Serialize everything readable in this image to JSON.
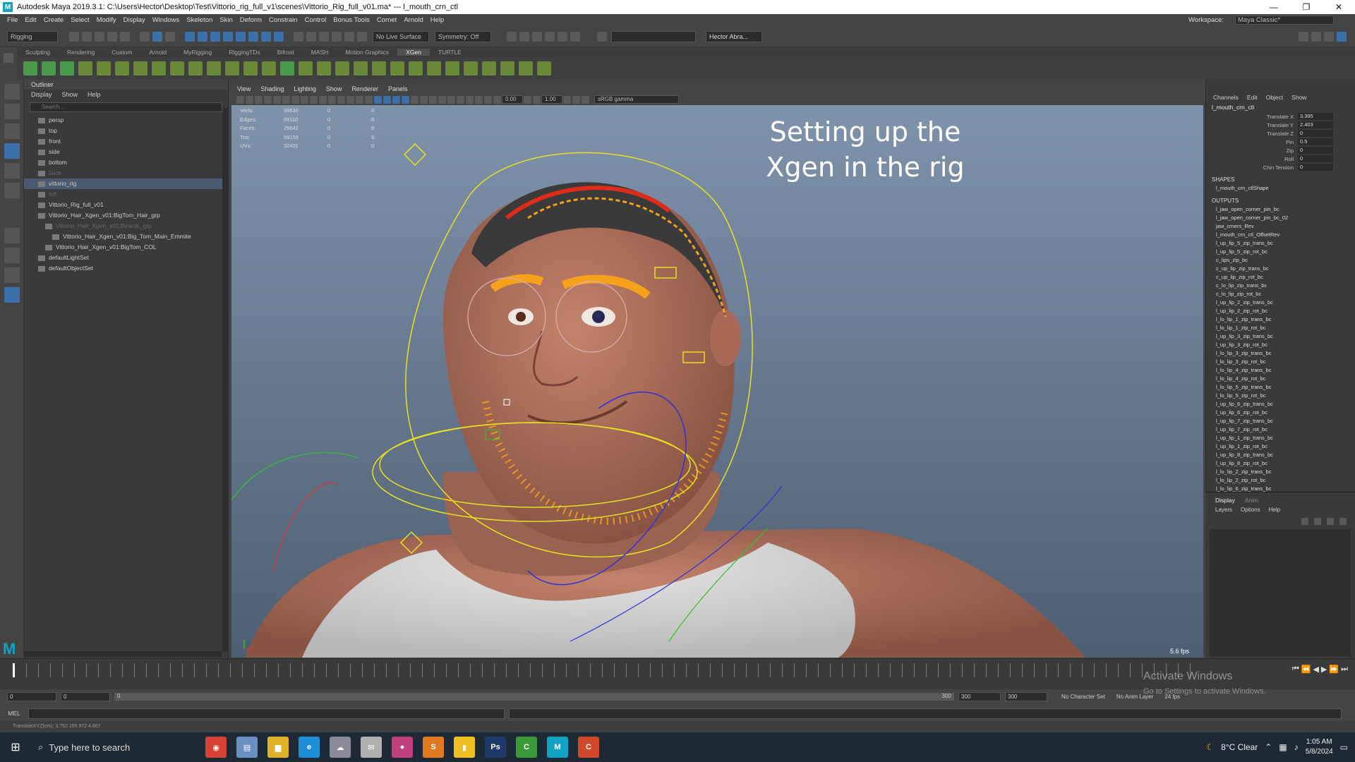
{
  "window": {
    "title": "Autodesk Maya 2019.3.1: C:\\Users\\Hector\\Desktop\\Test\\Vittorio_rig_full_v1\\scenes\\Vittorio_Rig_full_v01.ma*  ---  l_mouth_crn_ctl",
    "controls": [
      "—",
      "❐",
      "✕"
    ]
  },
  "menubar": {
    "items": [
      "File",
      "Edit",
      "Create",
      "Select",
      "Modify",
      "Display",
      "Windows",
      "Skeleton",
      "Skin",
      "Deform",
      "Constrain",
      "Control",
      "Bonus Tools",
      "Cornet",
      "Arnold",
      "Help"
    ],
    "workspace_label": "Workspace:",
    "workspace_value": "Maya Classic*"
  },
  "statusline": {
    "mode": "Rigging",
    "live_surface": "No Live Surface",
    "symmetry": "Symmetry: Off",
    "user": "Hector Abra..."
  },
  "shelf": {
    "tabs": [
      "Sculpting",
      "Rendering",
      "Custom",
      "Arnold",
      "MyRigging",
      "RiggingTDs",
      "Bifrost",
      "MASH",
      "Motion Graphics",
      "XGen",
      "TURTLE"
    ],
    "active_tab": "XGen"
  },
  "outliner": {
    "title": "Outliner",
    "menu": [
      "Display",
      "Show",
      "Help"
    ],
    "search_placeholder": "Search...",
    "items": [
      {
        "label": "persp",
        "indent": 1,
        "dim": false,
        "selected": false
      },
      {
        "label": "top",
        "indent": 1,
        "dim": false,
        "selected": false
      },
      {
        "label": "front",
        "indent": 1,
        "dim": false,
        "selected": false
      },
      {
        "label": "side",
        "indent": 1,
        "dim": false,
        "selected": false
      },
      {
        "label": "bottom",
        "indent": 1,
        "dim": false,
        "selected": false
      },
      {
        "label": "back",
        "indent": 1,
        "dim": true,
        "selected": false
      },
      {
        "label": "vittorio_rig",
        "indent": 1,
        "dim": false,
        "selected": true
      },
      {
        "label": "left",
        "indent": 1,
        "dim": true,
        "selected": false
      },
      {
        "label": "Vittorio_Rig_full_v01",
        "indent": 1,
        "dim": false,
        "selected": false
      },
      {
        "label": "Vittorio_Hair_Xgen_v01:BigTom_Hair_grp",
        "indent": 1,
        "dim": false,
        "selected": false
      },
      {
        "label": "Vittorio_Hair_Xgen_v01:Beards_grp",
        "indent": 2,
        "dim": true,
        "selected": false
      },
      {
        "label": "Vittorio_Hair_Xgen_v01:Big_Tom_Main_Emmite",
        "indent": 3,
        "dim": false,
        "selected": false
      },
      {
        "label": "Vittorio_Hair_Xgen_v01:BigTom_COL",
        "indent": 2,
        "dim": false,
        "selected": false
      },
      {
        "label": "defaultLightSet",
        "indent": 1,
        "dim": false,
        "selected": false
      },
      {
        "label": "defaultObjectSet",
        "indent": 1,
        "dim": false,
        "selected": false
      }
    ]
  },
  "viewport": {
    "menu": [
      "View",
      "Shading",
      "Lighting",
      "Show",
      "Renderer",
      "Panels"
    ],
    "field_a": "0.00",
    "field_b": "1.00",
    "color_space": "sRGB gamma",
    "hud": [
      {
        "label": "Verts:",
        "v1": "39530",
        "v2": "0",
        "v3": "0"
      },
      {
        "label": "Edges:",
        "v1": "69110",
        "v2": "0",
        "v3": "0"
      },
      {
        "label": "Faces:",
        "v1": "29642",
        "v2": "0",
        "v3": "0"
      },
      {
        "label": "Tris:",
        "v1": "59155",
        "v2": "0",
        "v3": "0"
      },
      {
        "label": "UVs:",
        "v1": "32431",
        "v2": "0",
        "v3": "0"
      }
    ],
    "overlay_line1": "Setting up the",
    "overlay_line2": "Xgen in the rig",
    "fps": "5.6 fps"
  },
  "channelbox": {
    "menu": [
      "Channels",
      "Edit",
      "Object",
      "Show"
    ],
    "node": "l_mouth_crn_ctl",
    "attributes": [
      {
        "name": "Translate X",
        "value": "3.395"
      },
      {
        "name": "Translate Y",
        "value": "2.403"
      },
      {
        "name": "Translate Z",
        "value": "0"
      },
      {
        "name": "Pin",
        "value": "0.5"
      },
      {
        "name": "Zip",
        "value": "0"
      },
      {
        "name": "Roll",
        "value": "0"
      },
      {
        "name": "Chin Tension",
        "value": "0"
      }
    ],
    "shapes_label": "SHAPES",
    "shape_item": "l_mouth_crn_ctlShape",
    "outputs_label": "OUTPUTS",
    "outputs": [
      "l_jaw_open_corner_pin_bc",
      "l_jaw_open_corner_pin_bc_02",
      "jaw_crners_Rev",
      "l_mouth_crn_ctl_OffsetRev",
      "l_up_lip_5_zip_trans_bc",
      "l_up_lip_5_zip_rot_bc",
      "c_lips_zip_bc",
      "c_up_lip_zip_trans_bc",
      "c_up_lip_zip_rot_bc",
      "c_lo_lip_zip_trans_bc",
      "c_lo_lip_zip_rot_bc",
      "l_up_lip_2_zip_trans_bc",
      "l_up_lip_2_zip_rot_bc",
      "l_lo_lip_1_zip_trans_bc",
      "l_lo_lip_1_zip_rot_bc",
      "l_up_lip_3_zip_trans_bc",
      "l_up_lip_3_zip_rot_bc",
      "l_lo_lip_3_zip_trans_bc",
      "l_lo_lip_3_zip_rot_bc",
      "l_lo_lip_4_zip_trans_bc",
      "l_lo_lip_4_zip_rot_bc",
      "l_lo_lip_5_zip_trans_bc",
      "l_lo_lip_5_zip_rot_bc",
      "l_up_lip_6_zip_trans_bc",
      "l_up_lip_6_zip_rot_bc",
      "l_up_lip_7_zip_trans_bc",
      "l_up_lip_7_zip_rot_bc",
      "l_up_lip_1_zip_trans_bc",
      "l_up_lip_1_zip_rot_bc",
      "l_up_lip_8_zip_trans_bc",
      "l_up_lip_8_zip_rot_bc",
      "l_lo_lip_2_zip_trans_bc",
      "l_lo_lip_2_zip_rot_bc",
      "l_lo_lip_6_zip_trans_bc"
    ]
  },
  "layers": {
    "tabs": [
      "Display",
      "Anim"
    ],
    "menu": [
      "Layers",
      "Options",
      "Help"
    ]
  },
  "range": {
    "start": "0",
    "playback_start": "0",
    "range_field": "0",
    "playback_end": "300",
    "end": "300",
    "end2": "300",
    "character_set": "No Character Set",
    "anim_layer": "No Anim Layer",
    "fps": "24 fps"
  },
  "cmdline": {
    "label": "MEL"
  },
  "helpline": {
    "text": "TranslateXYZ(cm):   3.752   155.972   4.667"
  },
  "watermark": {
    "title": "Activate Windows",
    "subtitle": "Go to Settings to activate Windows."
  },
  "taskbar": {
    "search_placeholder": "Type here to search",
    "weather": "8°C  Clear",
    "time": "1:05 AM",
    "date": "5/8/2024",
    "apps": [
      {
        "name": "chrome",
        "color": "#d64236",
        "glyph": "◉"
      },
      {
        "name": "notes",
        "color": "#6a8fc4",
        "glyph": "▤"
      },
      {
        "name": "explorer",
        "color": "#e0b22a",
        "glyph": "▆"
      },
      {
        "name": "edge",
        "color": "#1d8fd8",
        "glyph": "e"
      },
      {
        "name": "cloud",
        "color": "#8a8a9a",
        "glyph": "☁"
      },
      {
        "name": "mail",
        "color": "#b0b0b0",
        "glyph": "✉"
      },
      {
        "name": "media",
        "color": "#c04080",
        "glyph": "●"
      },
      {
        "name": "sublime",
        "color": "#e07a20",
        "glyph": "S"
      },
      {
        "name": "sticky",
        "color": "#f0c020",
        "glyph": "▮"
      },
      {
        "name": "photoshop",
        "color": "#1e3a6a",
        "glyph": "Ps"
      },
      {
        "name": "terminal",
        "color": "#3a9a3a",
        "glyph": "C"
      },
      {
        "name": "maya",
        "color": "#10a3c4",
        "glyph": "M"
      },
      {
        "name": "other",
        "color": "#d04a2a",
        "glyph": "C"
      }
    ]
  },
  "colors": {
    "accent": "#3d6fa8",
    "maya_teal": "#10a3c4"
  }
}
